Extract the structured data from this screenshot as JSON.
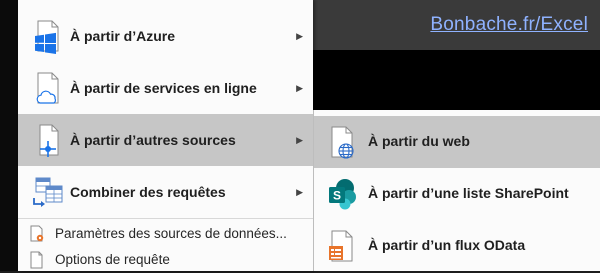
{
  "header": {
    "brand_link": "Bonbache.fr/Excel"
  },
  "menu": {
    "items": [
      {
        "label": "À partir d’Azure",
        "icon": "azure-windows-icon",
        "has_submenu": true
      },
      {
        "label": "À partir de services en ligne",
        "icon": "cloud-document-icon",
        "has_submenu": true
      },
      {
        "label": "À partir d’autres sources",
        "icon": "other-sources-icon",
        "has_submenu": true,
        "highlighted": true
      },
      {
        "label": "Combiner des requêtes",
        "icon": "combine-queries-icon",
        "has_submenu": true
      }
    ],
    "small_items": [
      {
        "label": "Paramètres des sources de données...",
        "icon": "data-source-settings-icon"
      },
      {
        "label": "Options de requête",
        "icon": "query-options-icon"
      }
    ]
  },
  "submenu": {
    "items": [
      {
        "label": "À partir du web",
        "icon": "web-globe-icon",
        "highlighted": true
      },
      {
        "label": "À partir d’une liste SharePoint",
        "icon": "sharepoint-icon"
      },
      {
        "label": "À partir d’un flux OData",
        "icon": "odata-feed-icon"
      }
    ]
  },
  "colors": {
    "menu_bg": "#fbfbfb",
    "highlight": "#c6c6c6",
    "link": "#8fb2ff",
    "azure_blue": "#1a73e8",
    "sharepoint_teal": "#047c78",
    "odata_orange": "#e8742b"
  }
}
